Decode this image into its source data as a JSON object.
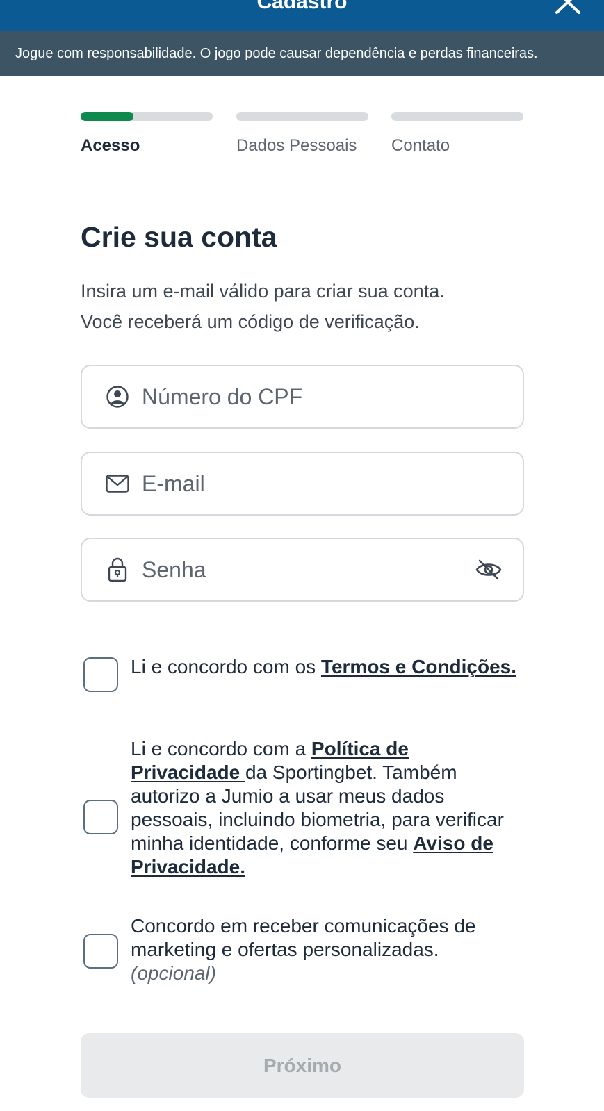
{
  "header": {
    "title": "Cadastro",
    "close_icon": "close-icon"
  },
  "banner": {
    "text": "Jogue com responsabilidade. O jogo pode causar dependência e perdas financeiras."
  },
  "stepper": {
    "active_index": 0,
    "active_progress": 0.4,
    "colors": {
      "active": "#0f8a4e",
      "track": "#d8dcdf"
    },
    "steps": [
      {
        "label": "Acesso"
      },
      {
        "label": "Dados Pessoais"
      },
      {
        "label": "Contato"
      }
    ]
  },
  "form": {
    "heading": "Crie sua conta",
    "subtitle_line1": "Insira um e-mail válido para criar sua conta.",
    "subtitle_line2": "Você receberá um código de verificação.",
    "cpf": {
      "placeholder": "Número do CPF",
      "value": "",
      "icon": "user-circle-icon"
    },
    "email": {
      "placeholder": "E-mail",
      "value": "",
      "icon": "mail-icon"
    },
    "password": {
      "placeholder": "Senha",
      "value": "",
      "icon": "lock-icon",
      "toggle_icon": "eye-off-icon"
    }
  },
  "consents": {
    "terms": {
      "checked": false,
      "text_before": "Li e concordo com os ",
      "link": "Termos e Condições."
    },
    "privacy": {
      "checked": false,
      "text_before": "Li e concordo com a ",
      "link": "Política de Privacidade ",
      "text_middle": "da Sportingbet. Também autorizo a Jumio a usar meus dados pessoais, incluindo biometria, para verificar minha identidade, conforme seu ",
      "link2": "Aviso de Privacidade."
    },
    "marketing": {
      "checked": false,
      "text": "Concordo em receber comunicações de marketing e ofertas personalizadas.",
      "optional": "(opcional)"
    }
  },
  "actions": {
    "next_label": "Próximo",
    "next_enabled": false
  },
  "colors": {
    "header_bg": "#0b5a93",
    "banner_bg": "#3d5464",
    "text": "#1e2b3a",
    "button_disabled_bg": "#e8eaec"
  }
}
